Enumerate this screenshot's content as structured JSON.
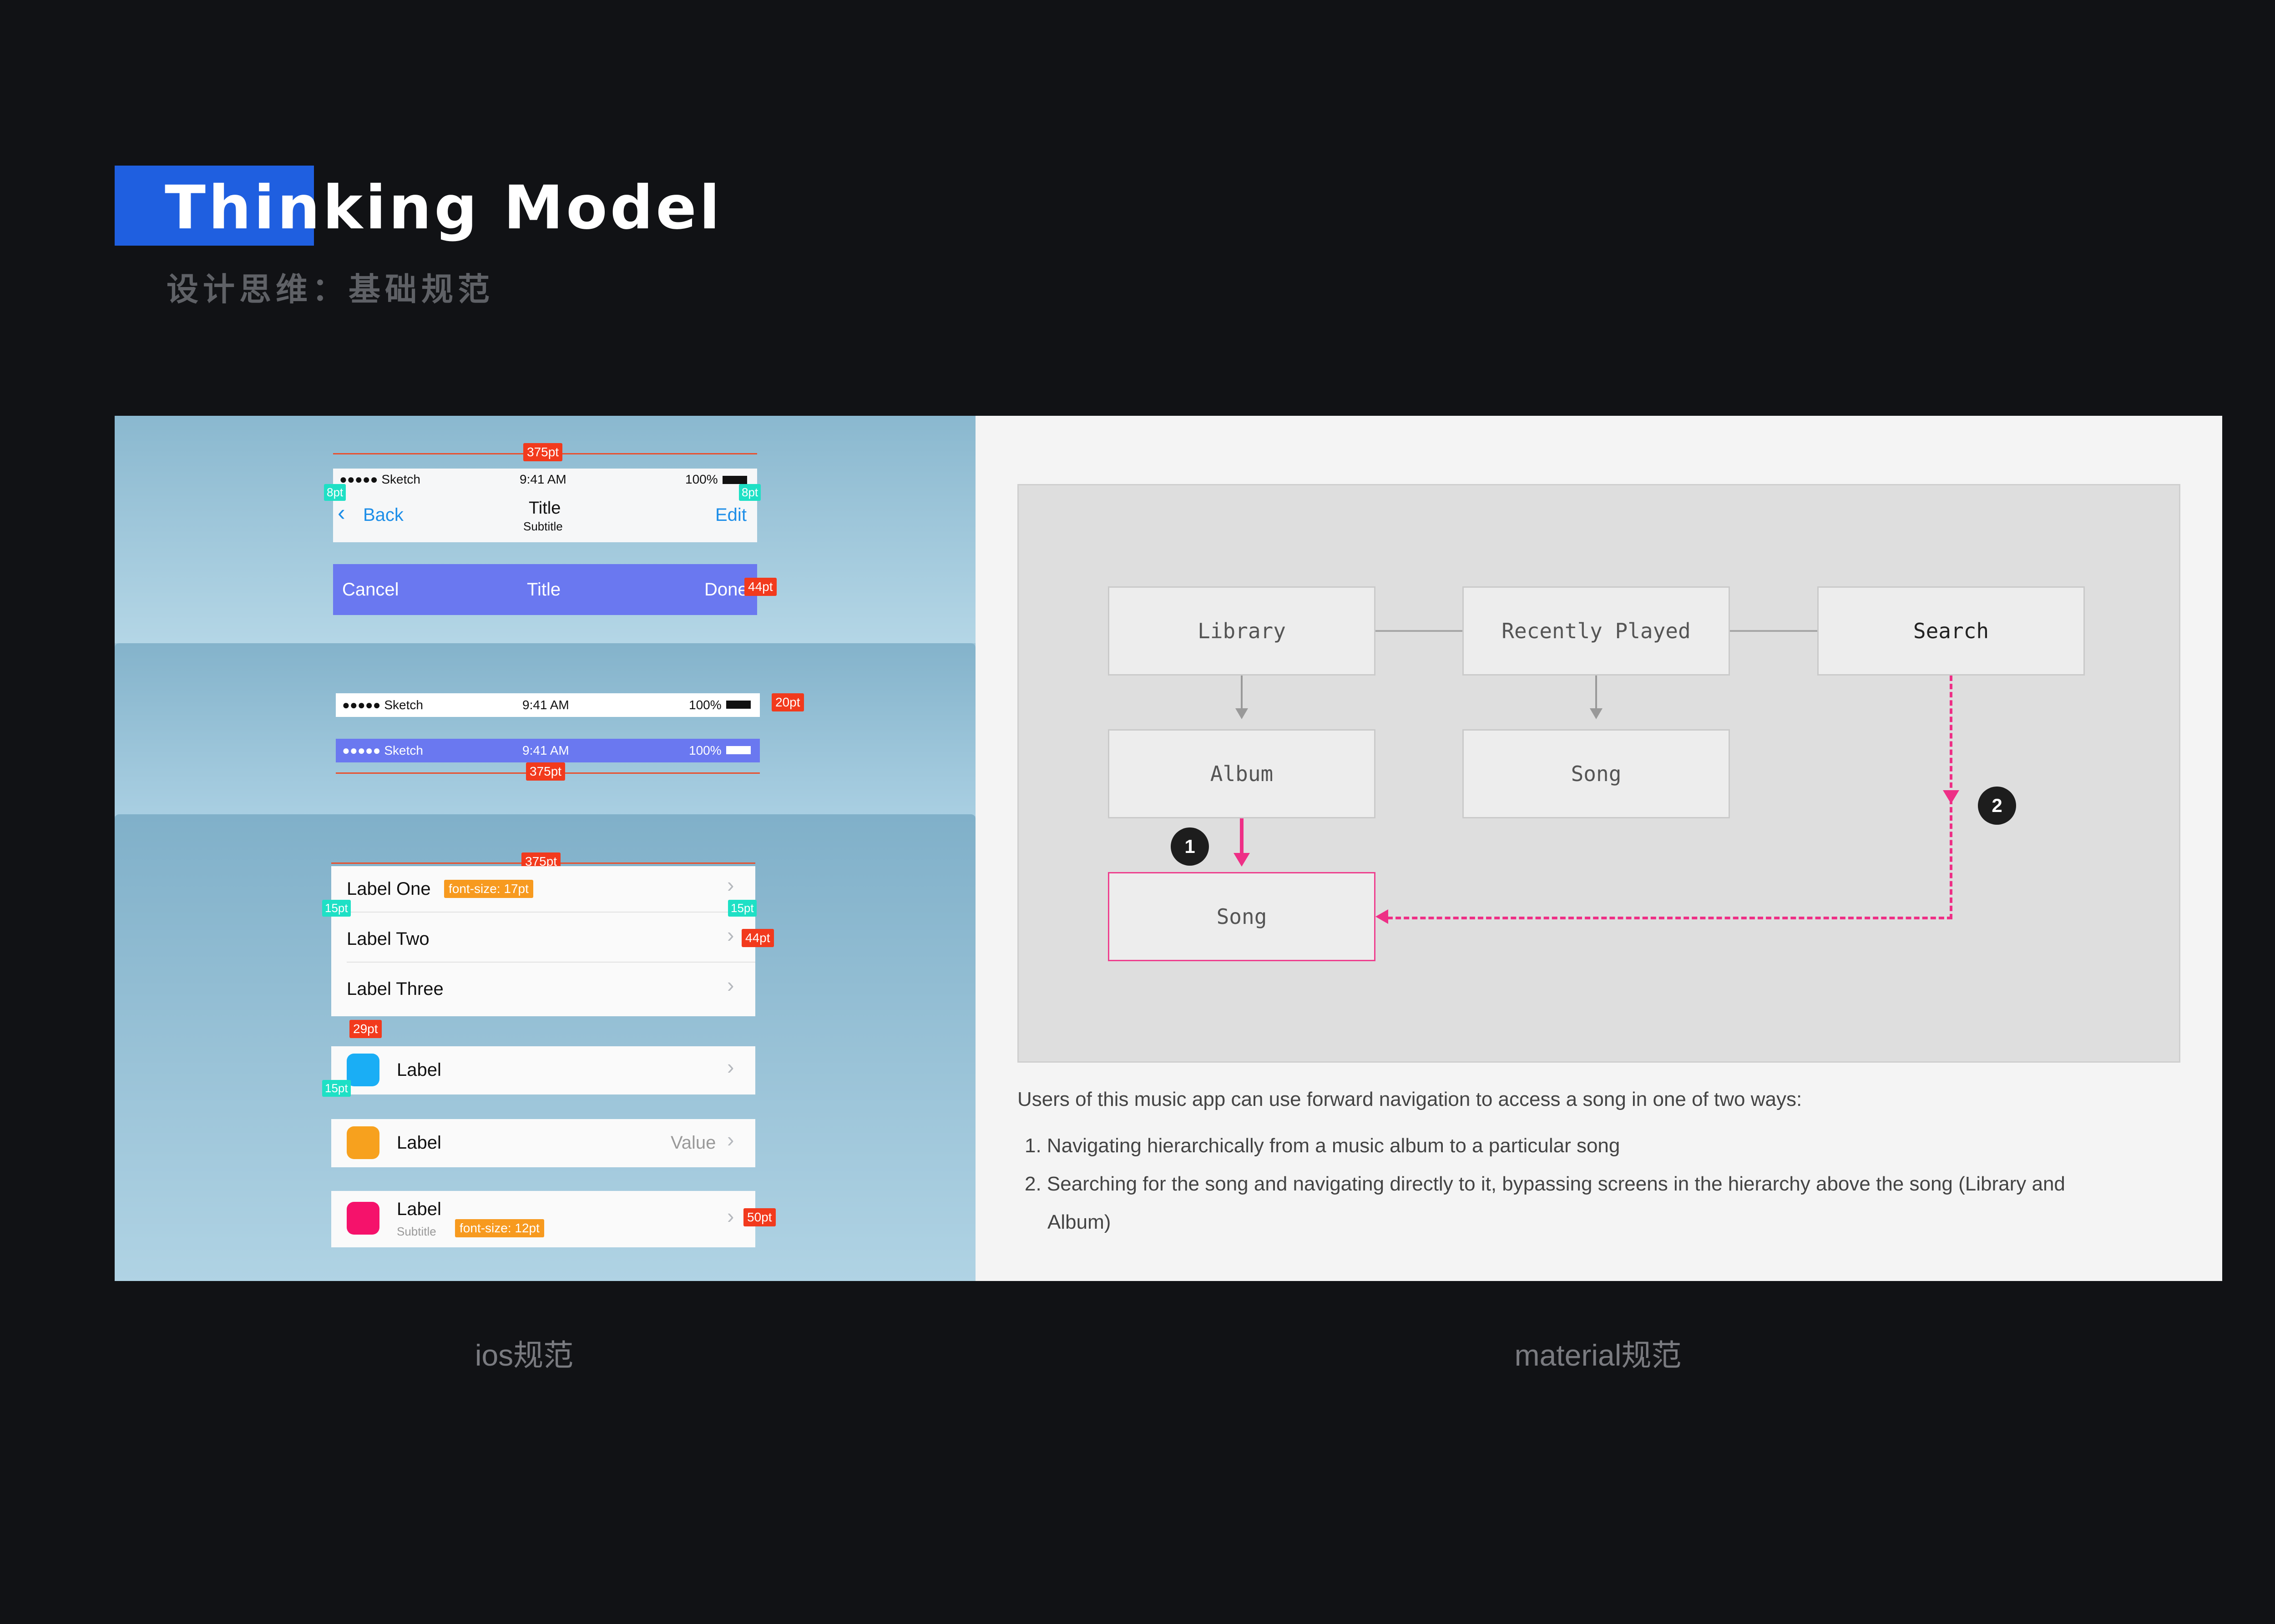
{
  "header": {
    "title": "Thinking Model",
    "subtitle": "设计思维：基础规范"
  },
  "ios": {
    "caption": "ios规范",
    "nav": {
      "width_tag": "375pt",
      "status_carrier": "●●●●● Sketch",
      "status_time": "9:41 AM",
      "status_battery": "100%",
      "back": "Back",
      "title": "Title",
      "subtitle": "Subtitle",
      "edit": "Edit",
      "left_margin_tag": "8pt",
      "right_margin_tag": "8pt"
    },
    "toolbar": {
      "cancel": "Cancel",
      "title": "Title",
      "done": "Done",
      "height_tag": "44pt"
    },
    "statusbars": {
      "carrier": "●●●●● Sketch",
      "time": "9:41 AM",
      "battery": "100%",
      "height_tag": "20pt",
      "width_tag": "375pt"
    },
    "list": {
      "width_tag": "375pt",
      "rows": [
        "Label One",
        "Label Two",
        "Label Three"
      ],
      "font_tag": "font-size: 17pt",
      "left_tag": "15pt",
      "right_tag": "15pt",
      "height_tag": "44pt",
      "icon_tag": "29pt",
      "icon_left_tag": "15pt",
      "cells": [
        {
          "label": "Label",
          "value": ""
        },
        {
          "label": "Label",
          "value": "Value"
        },
        {
          "label": "Label",
          "subtitle": "Subtitle",
          "value": ""
        }
      ],
      "sub_font_tag": "font-size: 12pt",
      "subtitle_height_tag": "50pt",
      "icon_colors": [
        "#1aaef5",
        "#f7a11e",
        "#f5126b"
      ]
    }
  },
  "material": {
    "caption": "material规范",
    "nodes": {
      "library": "Library",
      "recent": "Recently Played",
      "search": "Search",
      "album": "Album",
      "song_mid": "Song",
      "song_target": "Song"
    },
    "badges": [
      "1",
      "2"
    ],
    "intro": "Users of this music app can use forward navigation to access a song in one of two ways:",
    "items": [
      "1. Navigating hierarchically from a music album to a particular song",
      "2. Searching for the song and navigating directly to it, bypassing screens in the hierarchy above the song (Library and",
      "Album)"
    ]
  },
  "colors": {
    "accent": "#1f5fe0",
    "pink": "#ee2f86",
    "tag_red": "#f23a1d",
    "tag_teal": "#1ee0c5",
    "tag_orange": "#f79a1f"
  }
}
